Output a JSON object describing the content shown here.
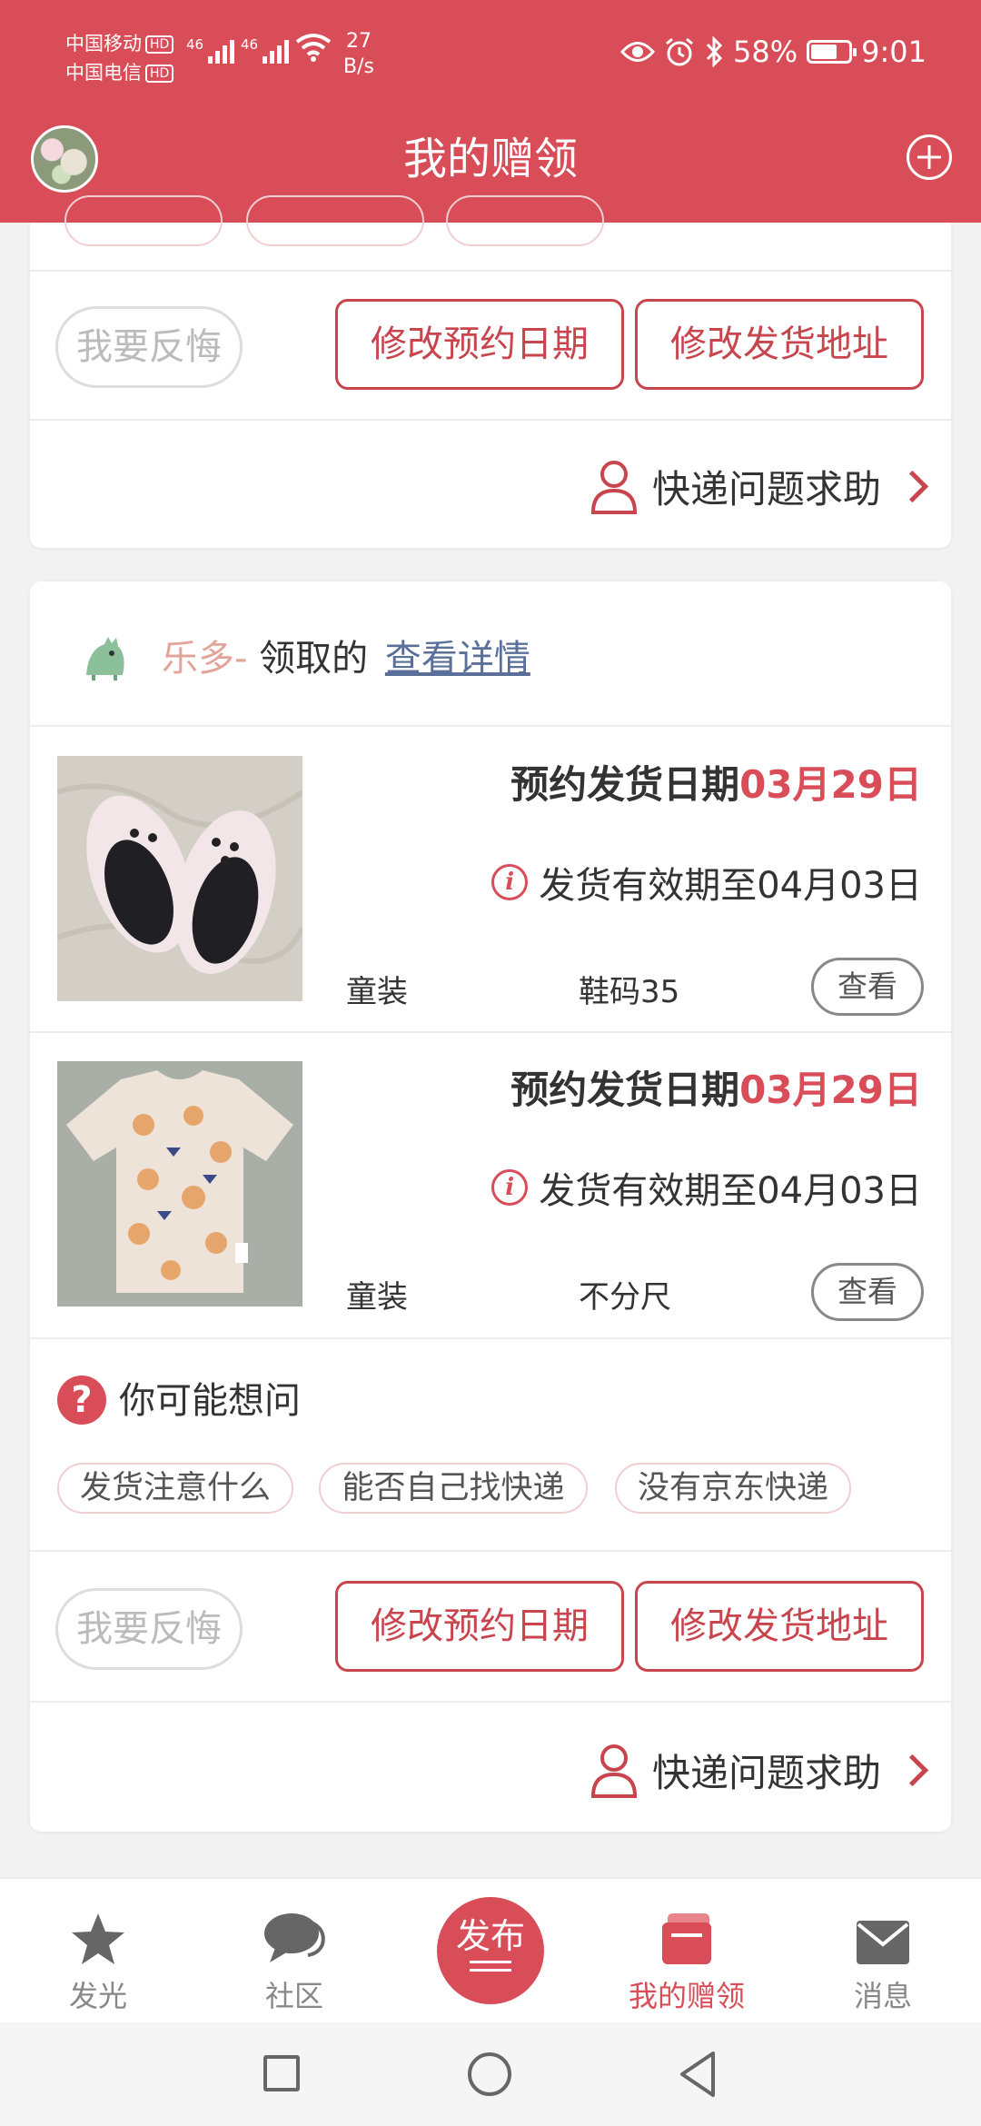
{
  "status_bar": {
    "carrier1": "中国移动",
    "carrier2": "中国电信",
    "hd": "HD",
    "net1": "46",
    "net2": "46",
    "speed_value": "27",
    "speed_unit": "B/s",
    "battery": "58%",
    "time": "9:01"
  },
  "header": {
    "title": "我的赠领"
  },
  "card1": {
    "regret_button": "我要反悔",
    "change_date_button": "修改预约日期",
    "change_address_button": "修改发货地址",
    "help_link": "快递问题求助"
  },
  "card2": {
    "claimer_name": "乐多-",
    "claimed_text": "领取的",
    "details_link": "查看详情",
    "items": [
      {
        "date_label": "预约发货日期",
        "date_value": "03月29日",
        "valid_text": "发货有效期至04月03日",
        "category": "童装",
        "size": "鞋码35",
        "view_button": "查看"
      },
      {
        "date_label": "预约发货日期",
        "date_value": "03月29日",
        "valid_text": "发货有效期至04月03日",
        "category": "童装",
        "size": "不分尺",
        "view_button": "查看"
      }
    ],
    "faq_title": "你可能想问",
    "faq_chips": [
      "发货注意什么",
      "能否自己找快递",
      "没有京东快递"
    ],
    "regret_button": "我要反悔",
    "change_date_button": "修改预约日期",
    "change_address_button": "修改发货地址",
    "help_link": "快递问题求助"
  },
  "tabbar": {
    "tab1": "发光",
    "tab2": "社区",
    "publish": "发布",
    "tab4": "我的赠领",
    "tab5": "消息"
  },
  "colors": {
    "brand": "#d84d57",
    "accent_red": "#c9454e"
  }
}
